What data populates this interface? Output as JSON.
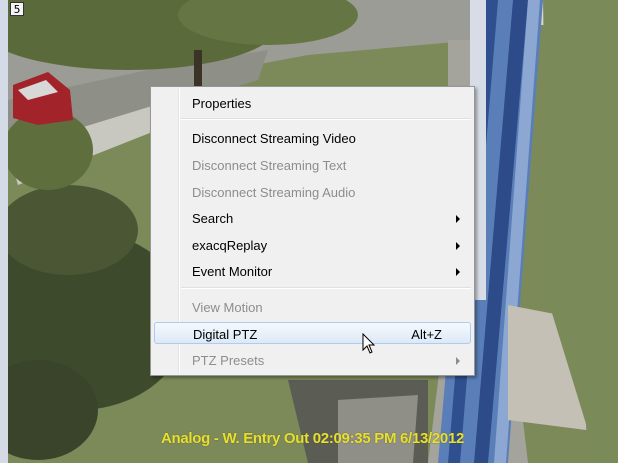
{
  "pane_index": "5",
  "overlay_caption": "Analog - W. Entry Out 02:09:35 PM 6/13/2012",
  "context_menu": {
    "items": [
      {
        "label": "Properties",
        "enabled": true
      },
      {
        "label": "Disconnect Streaming Video",
        "enabled": true
      },
      {
        "label": "Disconnect Streaming Text",
        "enabled": false
      },
      {
        "label": "Disconnect Streaming Audio",
        "enabled": false
      },
      {
        "label": "Search",
        "enabled": true,
        "submenu": true
      },
      {
        "label": "exacqReplay",
        "enabled": true,
        "submenu": true
      },
      {
        "label": "Event Monitor",
        "enabled": true,
        "submenu": true
      },
      {
        "label": "View Motion",
        "enabled": false
      },
      {
        "label": "Digital PTZ",
        "enabled": true,
        "shortcut": "Alt+Z",
        "highlighted": true
      },
      {
        "label": "PTZ Presets",
        "enabled": false,
        "submenu": true
      }
    ]
  },
  "colors": {
    "caption": "#e8e02a",
    "menu_background": "#f0f0f0",
    "highlight_border": "#aecbf0",
    "disabled_text": "#8d8d8d"
  }
}
